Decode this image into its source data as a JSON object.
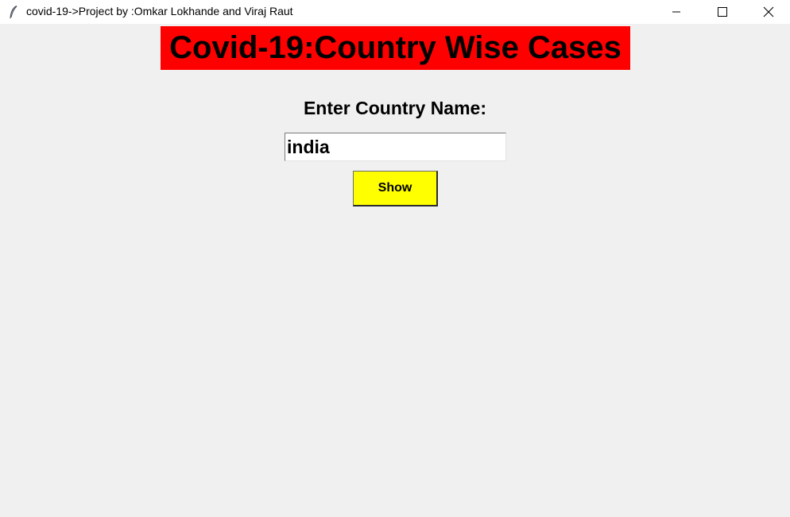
{
  "window": {
    "title": "covid-19->Project by :Omkar Lokhande and Viraj Raut",
    "app_icon": "feather-icon",
    "controls": [
      "minimize-icon",
      "maximize-icon",
      "close-icon"
    ]
  },
  "main": {
    "heading": "Covid-19:Country Wise Cases",
    "prompt_label": "Enter Country Name:",
    "country_input": {
      "value": "india"
    },
    "show_button_label": "Show"
  },
  "colors": {
    "heading_background": "#ff0000",
    "button_background": "#ffff00",
    "window_background": "#f0f0f0",
    "titlebar_background": "#ffffff"
  }
}
